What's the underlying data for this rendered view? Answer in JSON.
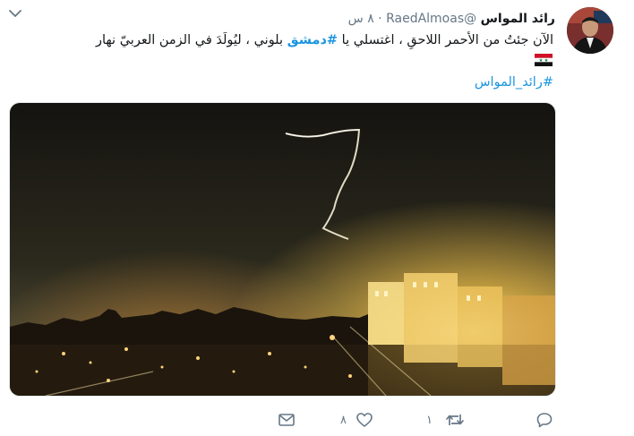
{
  "tweet": {
    "display_name": "رائد المواس",
    "handle": "@RaedAlmoas",
    "time": "٨ س",
    "text_before": "الآن جئتُ من الأحمر اللاحقِ ، اغتسلي يا ",
    "hashtag_main": "#دمشق",
    "text_after": " بلوني ، ليُولَدَ في الزمن العربيّ نهار",
    "hashtag_footer": "#رائد_المواس"
  },
  "actions": {
    "reply_count": "",
    "retweet_count": "١",
    "like_count": "٨"
  },
  "colors": {
    "link": "#1b95e0",
    "muted": "#657786",
    "text": "#14171a"
  },
  "icons": {
    "more": "chevron-down-icon",
    "reply": "reply-icon",
    "retweet": "retweet-icon",
    "like": "heart-icon",
    "dm": "envelope-icon"
  }
}
